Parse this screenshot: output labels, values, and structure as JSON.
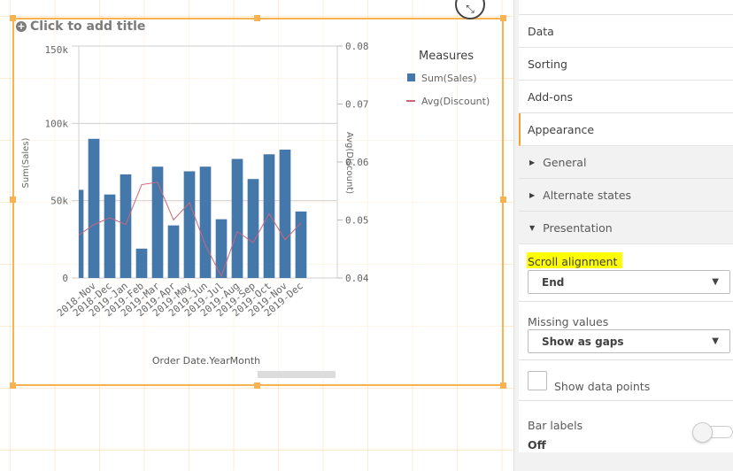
{
  "chart_panel": {
    "title_placeholder": "Click to add title",
    "expand_icon": "collapse-arrows-icon"
  },
  "legend": {
    "title": "Measures",
    "items": [
      {
        "label": "Sum(Sales)",
        "color": "#4477aa",
        "type": "bar"
      },
      {
        "label": "Avg(Discount)",
        "color": "#cc6677",
        "type": "line"
      }
    ]
  },
  "chart_data": {
    "type": "bar+line combo",
    "xlabel": "Order Date.YearMonth",
    "ylabel": "Sum(Sales)",
    "y2label": "Avg(Discount)",
    "categories": [
      "",
      "2018-Nov",
      "2018-Dec",
      "2019-Jan",
      "2019-Feb",
      "2019-Mar",
      "2019-Apr",
      "2019-May",
      "2019-Jun",
      "2019-Jul",
      "2019-Aug",
      "2019-Sep",
      "2019-Oct",
      "2019-Nov",
      "2019-Dec"
    ],
    "ylim": [
      0,
      150000
    ],
    "y_ticks": [
      "0",
      "50k",
      "100k",
      "150k"
    ],
    "y2lim": [
      0.04,
      0.08
    ],
    "y2_ticks": [
      "0.04",
      "0.05",
      "0.06",
      "0.07",
      "0.08"
    ],
    "series": [
      {
        "name": "Sum(Sales)",
        "type": "bar",
        "axis": "left",
        "values": [
          57000,
          90000,
          54000,
          67000,
          19000,
          72000,
          34000,
          69000,
          72000,
          38000,
          77000,
          64000,
          80000,
          83000,
          43000
        ]
      },
      {
        "name": "Avg(Discount)",
        "type": "line",
        "axis": "right",
        "values": [
          0.0473,
          0.0492,
          0.0504,
          0.0492,
          0.0561,
          0.0565,
          0.05,
          0.053,
          0.0457,
          0.0403,
          0.048,
          0.0461,
          0.0511,
          0.0466,
          0.0495
        ]
      }
    ],
    "grid": "horizontal",
    "legend_position": "right",
    "scrolled": true
  },
  "panel": {
    "tabs": [
      {
        "label": "Data"
      },
      {
        "label": "Sorting"
      },
      {
        "label": "Add-ons"
      },
      {
        "label": "Appearance",
        "active": true
      }
    ],
    "groups": [
      {
        "label": "General",
        "expanded": false
      },
      {
        "label": "Alternate states",
        "expanded": false
      },
      {
        "label": "Presentation",
        "expanded": true
      }
    ],
    "scroll_alignment": {
      "label": "Scroll alignment",
      "value": "End",
      "highlight": "#ffff00"
    },
    "missing_values": {
      "label": "Missing values",
      "value": "Show as gaps"
    },
    "show_data_points": {
      "label": "Show data points",
      "checked": false
    },
    "bar_labels": {
      "label": "Bar labels",
      "value": "Off",
      "toggle_on": false
    }
  },
  "colors": {
    "selection": "#f8b250",
    "accent": "#f8a029"
  }
}
